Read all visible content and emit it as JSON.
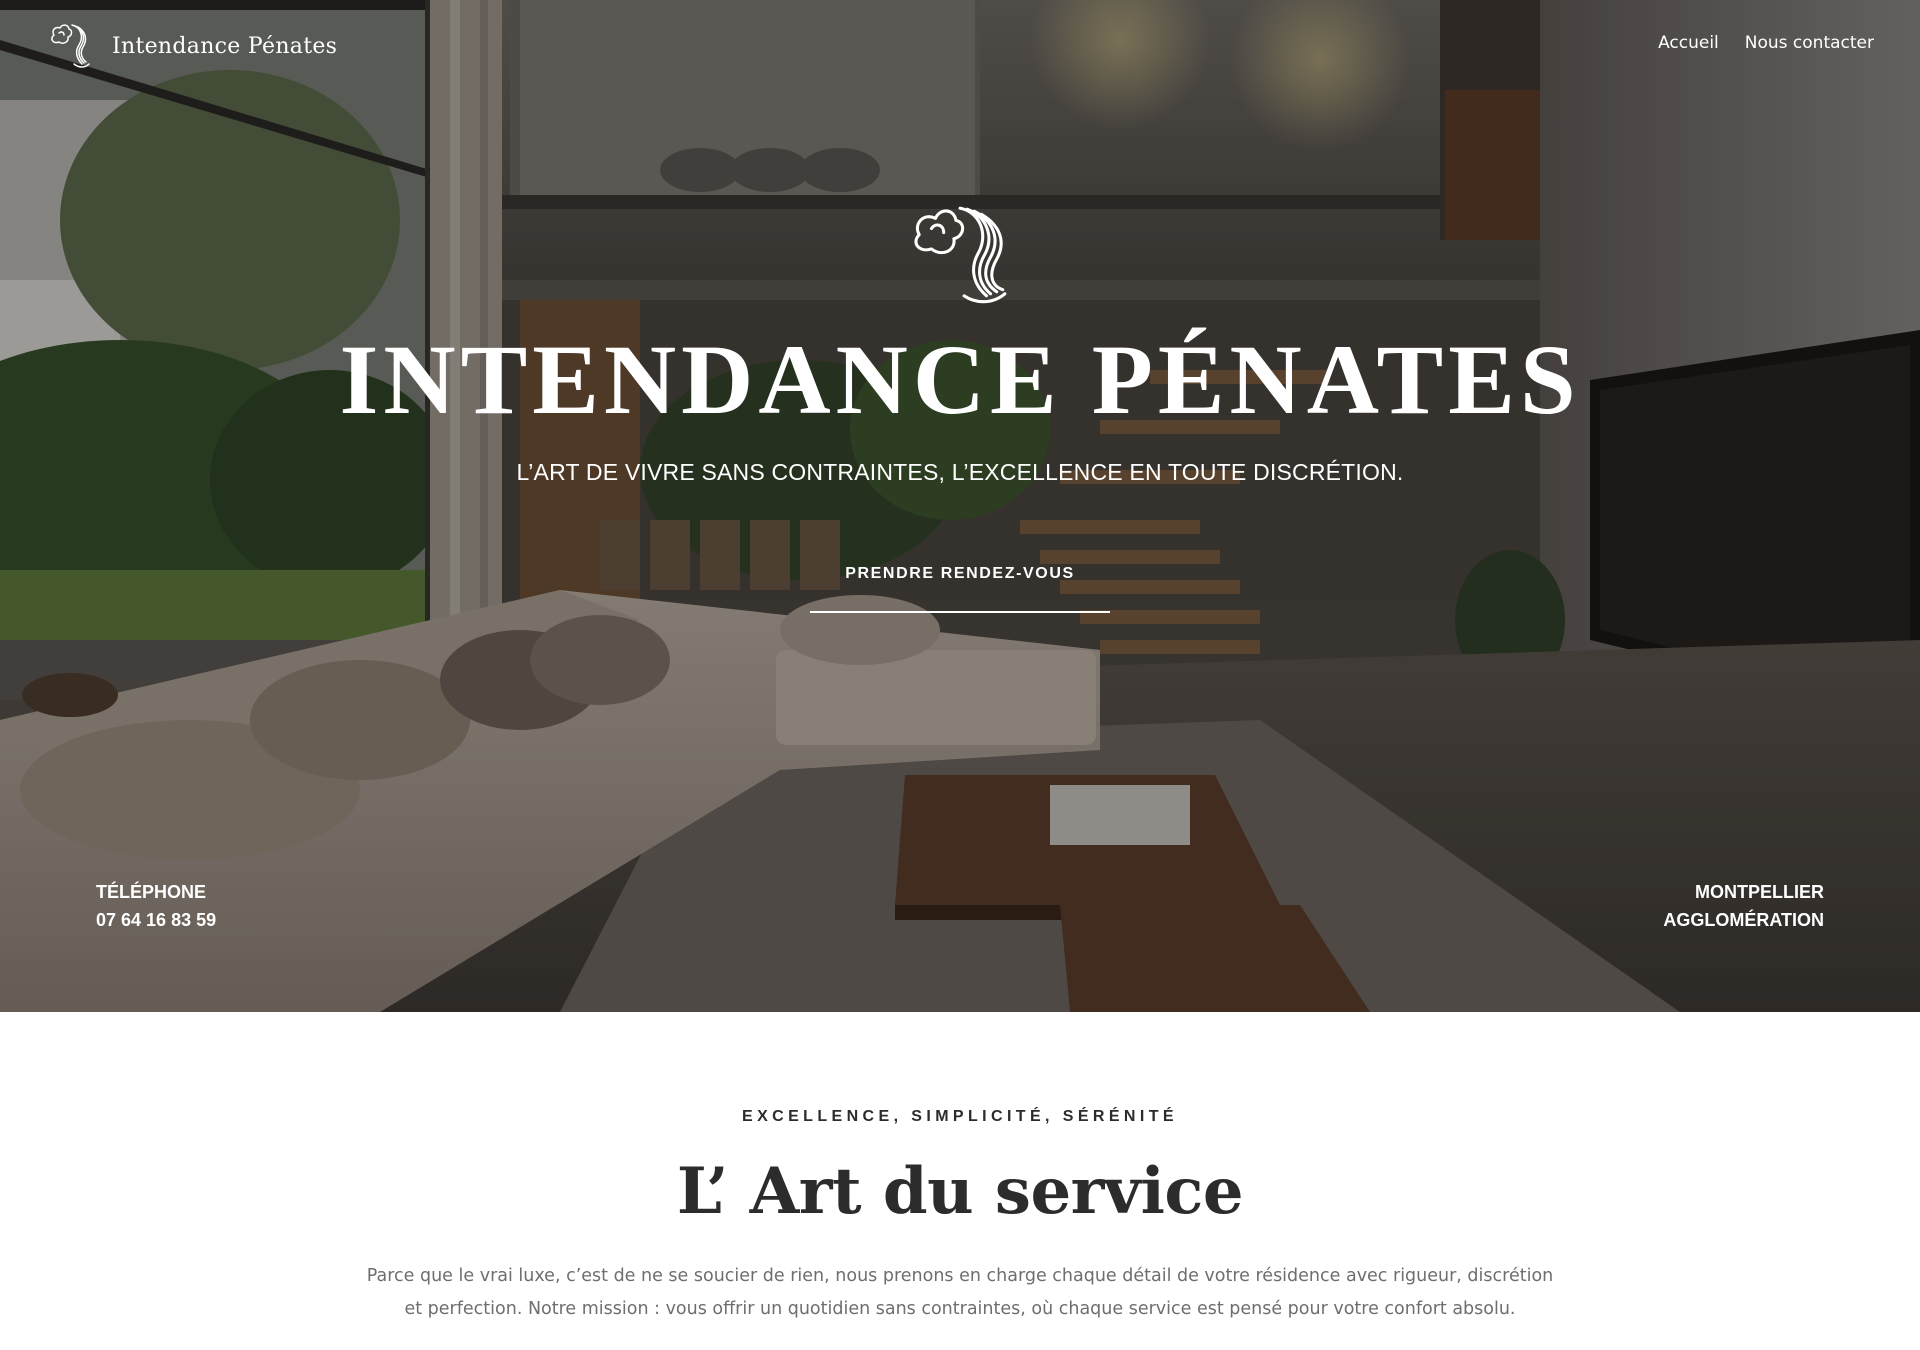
{
  "header": {
    "brand_name": "Intendance Pénates",
    "nav": [
      {
        "label": "Accueil"
      },
      {
        "label": "Nous contacter"
      }
    ]
  },
  "hero": {
    "title": "INTENDANCE PÉNATES",
    "tagline": "L’ART DE VIVRE SANS CONTRAINTES, L’EXCELLENCE EN TOUTE DISCRÉTION.",
    "cta_label": "PRENDRE RENDEZ-VOUS",
    "phone_label": "TÉLÉPHONE",
    "phone_number": "07 64 16 83 59",
    "location_line1": "MONTPELLIER",
    "location_line2": "AGGLOMÉRATION"
  },
  "intro": {
    "eyebrow": "EXCELLENCE, SIMPLICITÉ, SÉRÉNITÉ",
    "title": "L’ Art du service",
    "body": "Parce que le vrai luxe, c’est de ne se soucier de rien, nous prenons en charge chaque détail de votre résidence avec rigueur, discrétion et perfection. Notre mission : vous offrir un quotidien sans contraintes, où chaque service est pensé pour votre confort absolu."
  },
  "icons": {
    "logo": "aquarius-water-bearer-logo-icon"
  },
  "colors": {
    "hero_text": "#ffffff",
    "heading": "#2c2c2c",
    "body_text": "#6e6e6e"
  }
}
